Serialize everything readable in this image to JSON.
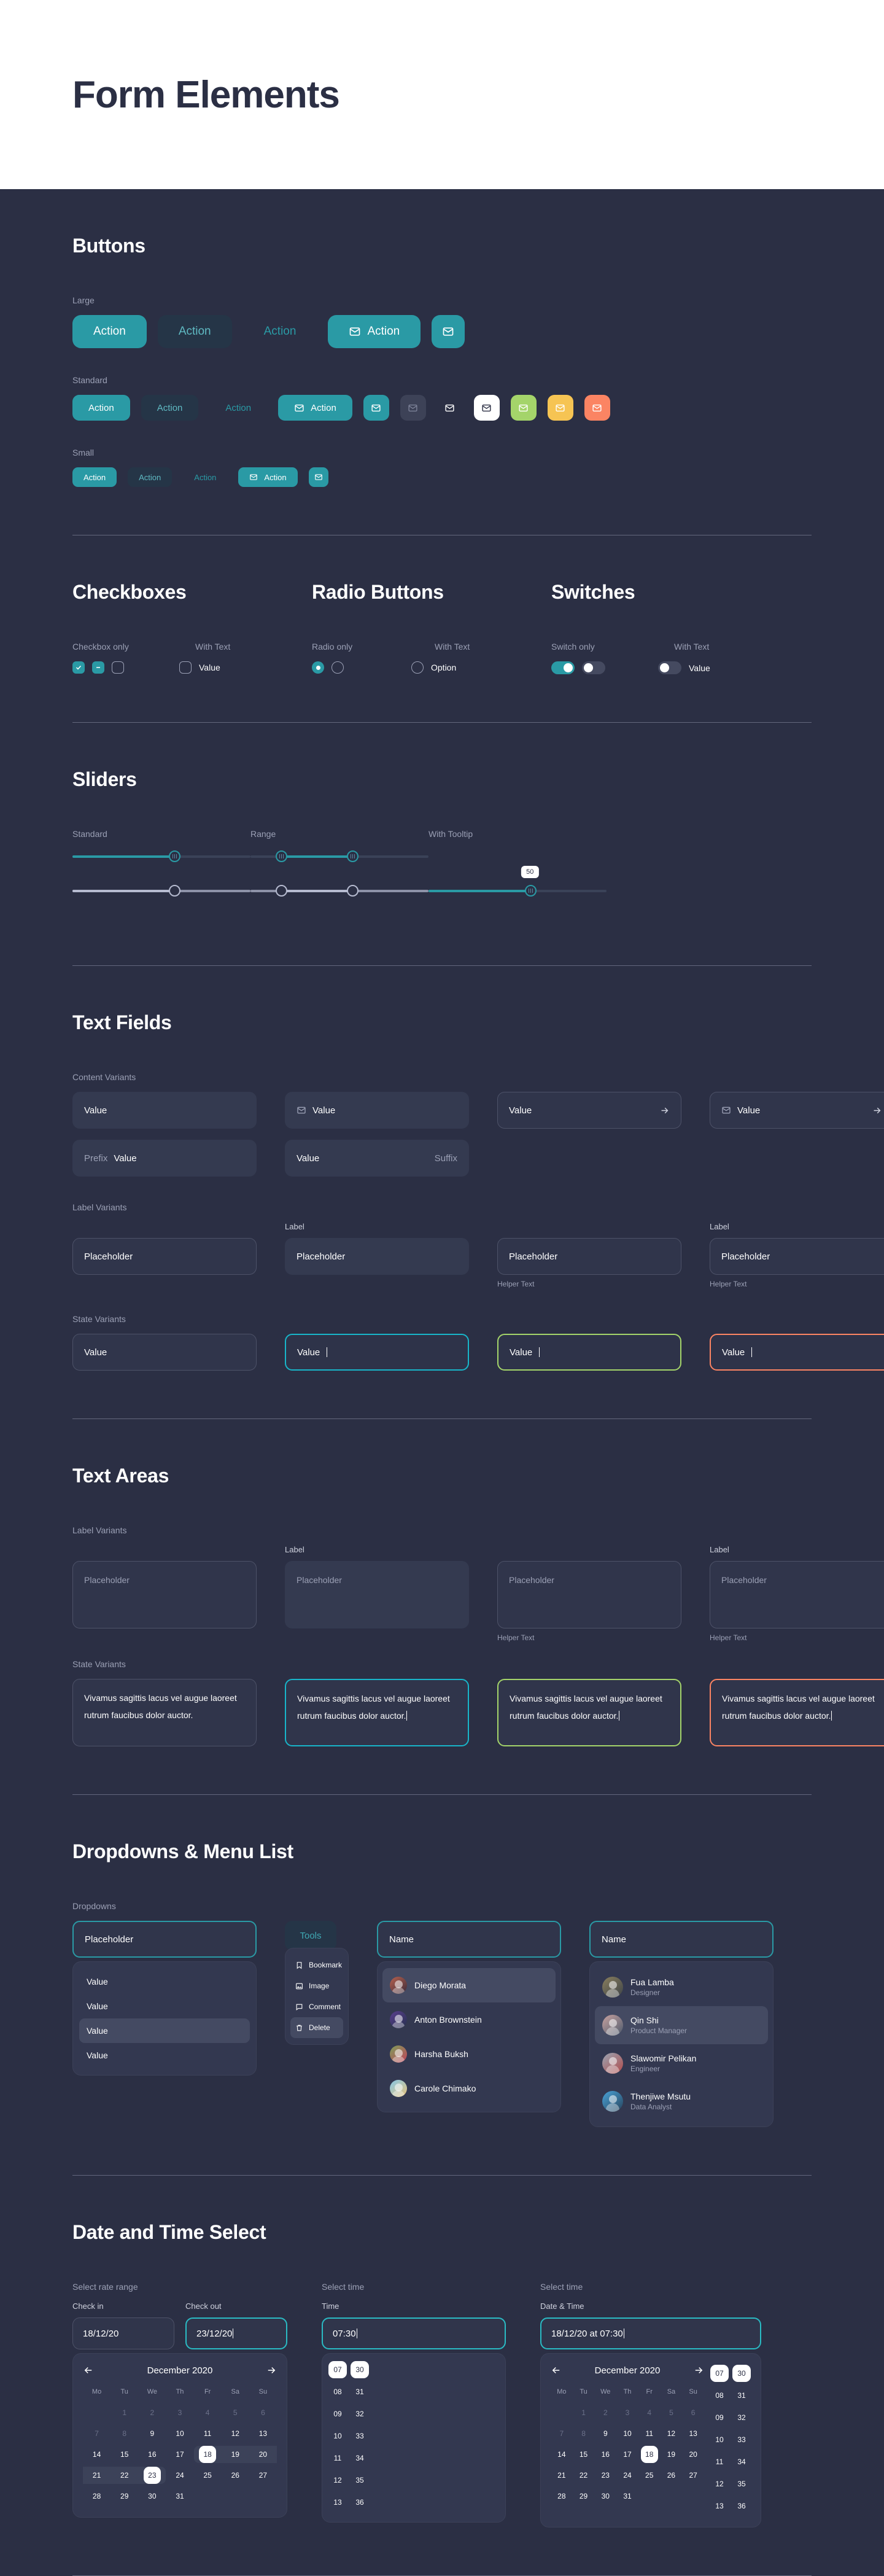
{
  "page": {
    "title": "Form Elements"
  },
  "sections": {
    "buttons": {
      "title": "Buttons",
      "sizes": {
        "large": "Large",
        "standard": "Standard",
        "small": "Small"
      },
      "action_label": "Action",
      "icon_name": "mail-icon",
      "colors": {
        "primary": "#2a9aa5",
        "tonal": "#253547",
        "muted": "#3d4257",
        "white": "#ffffff",
        "green": "#a4d46a",
        "amber": "#f6c453",
        "coral": "#fb8463"
      }
    },
    "checkboxes": {
      "title": "Checkboxes",
      "label_only": "Checkbox only",
      "label_with_text": "With Text",
      "text_value": "Value"
    },
    "radios": {
      "title": "Radio Buttons",
      "label_only": "Radio only",
      "label_with_text": "With Text",
      "text_value": "Option"
    },
    "switches": {
      "title": "Switches",
      "label_only": "Switch only",
      "label_with_text": "With Text",
      "text_value": "Value"
    },
    "sliders": {
      "title": "Sliders",
      "standard_label": "Standard",
      "range_label": "Range",
      "tooltip_label": "With Tooltip",
      "tooltip_value": "50"
    },
    "textfields": {
      "title": "Text Fields",
      "content_variants": "Content Variants",
      "label_variants": "Label Variants",
      "state_variants": "State Variants",
      "value": "Value",
      "placeholder": "Placeholder",
      "label": "Label",
      "helper": "Helper Text",
      "prefix": "Prefix",
      "suffix": "Suffix"
    },
    "textareas": {
      "title": "Text Areas",
      "label_variants": "Label Variants",
      "state_variants": "State Variants",
      "placeholder": "Placeholder",
      "label": "Label",
      "helper": "Helper Text",
      "body": "Vivamus sagittis lacus vel augue laoreet rutrum faucibus dolor auctor."
    },
    "dropdowns": {
      "title": "Dropdowns & Menu List",
      "sub_label": "Dropdowns",
      "select_placeholder": "Placeholder",
      "options": [
        "Value",
        "Value",
        "Value",
        "Value"
      ],
      "selected_index": 2,
      "tools_label": "Tools",
      "menu_items": [
        {
          "label": "Bookmark",
          "icon": "bookmark-icon"
        },
        {
          "label": "Image",
          "icon": "image-icon"
        },
        {
          "label": "Comment",
          "icon": "comment-icon"
        },
        {
          "label": "Delete",
          "icon": "trash-icon"
        }
      ],
      "menu_active_index": 3,
      "name_placeholder": "Name",
      "people_simple": [
        {
          "name": "Diego Morata"
        },
        {
          "name": "Anton Brownstein"
        },
        {
          "name": "Harsha Buksh"
        },
        {
          "name": "Carole Chimako"
        }
      ],
      "people_simple_active": 0,
      "people_detailed": [
        {
          "name": "Fua Lamba",
          "role": "Designer"
        },
        {
          "name": "Qin Shi",
          "role": "Product Manager"
        },
        {
          "name": "Slawomir Pelikan",
          "role": "Engineer"
        },
        {
          "name": "Thenjiwe Msutu",
          "role": "Data Analyst"
        }
      ],
      "people_detailed_active": 1
    },
    "datetime": {
      "title": "Date and Time Select",
      "rate_range_label": "Select rate range",
      "select_time_label": "Select time",
      "checkin_label": "Check in",
      "checkout_label": "Check out",
      "time_label": "Time",
      "datetime_label": "Date & Time",
      "checkin_value": "18/12/20",
      "checkout_value": "23/12/20",
      "time_value": "07:30",
      "datetime_value": "18/12/20 at 07:30",
      "month_title": "December 2020",
      "dow": [
        "Mo",
        "Tu",
        "We",
        "Th",
        "Fr",
        "Sa",
        "Su"
      ],
      "leading_blanks": 1,
      "days": [
        1,
        2,
        3,
        4,
        5,
        6,
        7,
        8,
        9,
        10,
        11,
        12,
        13,
        14,
        15,
        16,
        17,
        18,
        19,
        20,
        21,
        22,
        23,
        24,
        25,
        26,
        27,
        28,
        29,
        30,
        31
      ],
      "disabled_days": [
        1,
        2,
        3,
        4,
        5,
        6,
        7,
        8
      ],
      "range_start": 18,
      "range_end": 23,
      "single_selected": 18,
      "hours": [
        "07",
        "08",
        "09",
        "10",
        "11",
        "12",
        "13"
      ],
      "minutes": [
        "30",
        "31",
        "32",
        "33",
        "34",
        "35",
        "36"
      ],
      "hour_selected": "07",
      "minute_selected": "30"
    }
  }
}
